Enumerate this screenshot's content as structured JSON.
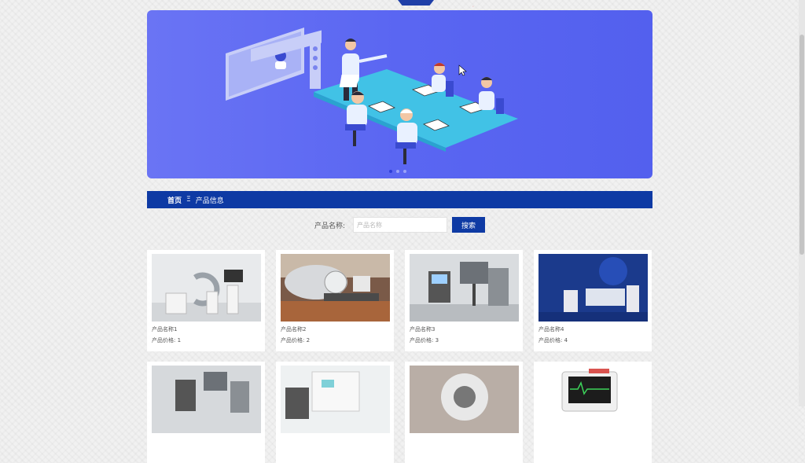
{
  "banner": {
    "active_slide": 1,
    "slide_count": 3
  },
  "breadcrumb": {
    "home": "首页",
    "separator": "Ξ",
    "current": "产品信息"
  },
  "search": {
    "label": "产品名称:",
    "placeholder": "产品名称",
    "button": "搜索"
  },
  "products": [
    {
      "name": "产品名称1",
      "price": "产品价格: 1"
    },
    {
      "name": "产品名称2",
      "price": "产品价格: 2"
    },
    {
      "name": "产品名称3",
      "price": "产品价格: 3"
    },
    {
      "name": "产品名称4",
      "price": "产品价格: 4"
    }
  ],
  "colors": {
    "primary": "#0e3aa4",
    "banner": "#5a66f2"
  }
}
